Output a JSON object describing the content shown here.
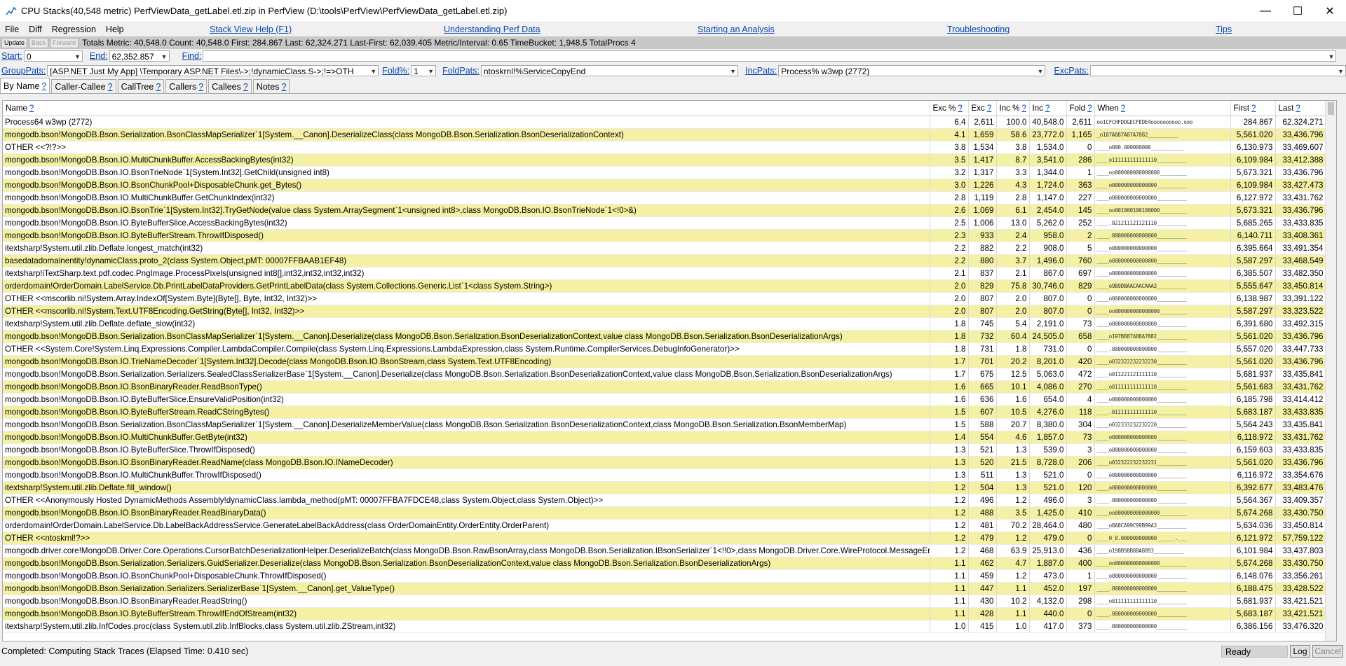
{
  "window": {
    "title": "CPU Stacks(40,548 metric) PerfViewData_getLabel.etl.zip in PerfView (D:\\tools\\PerfView\\PerfViewData_getLabel.etl.zip)",
    "minimize": "—",
    "maximize": "☐",
    "close": "✕"
  },
  "menu": {
    "items": [
      "File",
      "Diff",
      "Regression",
      "Help"
    ],
    "links": [
      "Stack View Help (F1)",
      "Understanding Perf Data",
      "Starting an Analysis",
      "Troubleshooting",
      "Tips"
    ]
  },
  "toolbar": {
    "update": "Update",
    "back": "Back",
    "forward": "Forward",
    "totals": "Totals Metric: 40,548.0  Count: 40,548.0  First: 284.867  Last: 62,324.271  Last-First: 62,039.405  Metric/Interval: 0.65  TimeBucket: 1,948.5  TotalProcs 4"
  },
  "filters": {
    "start_label": "Start:",
    "start_value": "0",
    "end_label": "End:",
    "end_value": "62,352.857",
    "find_label": "Find:",
    "find_value": "",
    "grouppats_label": "GroupPats:",
    "grouppats_value": "[ASP.NET Just My App] \\Temporary ASP.NET Files\\->;!dynamicClass.S->;!=>OTH",
    "fold_label": "Fold%:",
    "fold_value": "1",
    "foldpats_label": "FoldPats:",
    "foldpats_value": "ntoskrnl!%ServiceCopyEnd",
    "incpats_label": "IncPats:",
    "incpats_value": "Process% w3wp (2772)",
    "excpats_label": "ExcPats:",
    "excpats_value": ""
  },
  "tabs": [
    "By Name",
    "Caller-Callee",
    "CallTree",
    "Callers",
    "Callees",
    "Notes"
  ],
  "help_mark": "?",
  "columns": [
    "Name",
    "Exc %",
    "Exc",
    "Inc %",
    "Inc",
    "Fold",
    "When",
    "First",
    "Last"
  ],
  "rows": [
    {
      "name": "Process64 w3wp (2772)",
      "exc_pct": "6.4",
      "exc": "2,611",
      "inc_pct": "100.0",
      "inc": "40,548.0",
      "fold": "2,611",
      "when": "oo1CFCHFDDGECFEDE4oooooooooo.ooo",
      "first": "284.867",
      "last": "62,324.271",
      "hl": false
    },
    {
      "name": "mongodb.bson!MongoDB.Bson.Serialization.BsonClassMapSerializer`1[System.__Canon].DeserializeClass(class MongoDB.Bson.Serialization.BsonDeserializationContext)",
      "exc_pct": "4.1",
      "exc": "1,659",
      "inc_pct": "58.6",
      "inc": "23,772.0",
      "fold": "1,165",
      "when": "_o187A887A87A7882__________",
      "first": "5,561.020",
      "last": "33,436.796",
      "hl": true
    },
    {
      "name": "OTHER <<?!?>>",
      "exc_pct": "3.8",
      "exc": "1,534",
      "inc_pct": "3.8",
      "inc": "1,534.0",
      "fold": "0",
      "when": "____o000.000000000___________",
      "first": "6,130.973",
      "last": "33,469.607",
      "hl": false
    },
    {
      "name": "mongodb.bson!MongoDB.Bson.IO.MultiChunkBuffer.AccessBackingBytes(int32)",
      "exc_pct": "3.5",
      "exc": "1,417",
      "inc_pct": "8.7",
      "inc": "3,541.0",
      "fold": "286",
      "when": "____o111111111111110__________",
      "first": "6,109.984",
      "last": "33,412.388",
      "hl": true
    },
    {
      "name": "mongodb.bson!MongoDB.Bson.IO.BsonTrieNode`1[System.Int32].GetChild(unsigned int8)",
      "exc_pct": "3.2",
      "exc": "1,317",
      "inc_pct": "3.3",
      "inc": "1,344.0",
      "fold": "1",
      "when": "____oo000000000000000_________",
      "first": "5,673.321",
      "last": "33,436.796",
      "hl": false
    },
    {
      "name": "mongodb.bson!MongoDB.Bson.IO.BsonChunkPool+DisposableChunk.get_Bytes()",
      "exc_pct": "3.0",
      "exc": "1,226",
      "inc_pct": "4.3",
      "inc": "1,724.0",
      "fold": "363",
      "when": "____o000000000000000__________",
      "first": "6,109.984",
      "last": "33,427.473",
      "hl": true
    },
    {
      "name": "mongodb.bson!MongoDB.Bson.IO.MultiChunkBuffer.GetChunkIndex(int32)",
      "exc_pct": "2.8",
      "exc": "1,119",
      "inc_pct": "2.8",
      "inc": "1,147.0",
      "fold": "227",
      "when": "____o000000000000000__________",
      "first": "6,127.972",
      "last": "33,431.762",
      "hl": false
    },
    {
      "name": "mongodb.bson!MongoDB.Bson.IO.BsonTrie`1[System.Int32].TryGetNode(value class System.ArraySegment`1<unsigned int8>,class MongoDB.Bson.IO.BsonTrieNode`1<!0>&)",
      "exc_pct": "2.6",
      "exc": "1,069",
      "inc_pct": "6.1",
      "inc": "2,454.0",
      "fold": "145",
      "when": "____oo001000100100000_________",
      "first": "5,673.321",
      "last": "33,436.796",
      "hl": true
    },
    {
      "name": "mongodb.bson!MongoDB.Bson.IO.ByteBufferSlice.AccessBackingBytes(int32)",
      "exc_pct": "2.5",
      "exc": "1,006",
      "inc_pct": "13.0",
      "inc": "5,262.0",
      "fold": "252",
      "when": "____.021211121121110__________",
      "first": "5,685.265",
      "last": "33,433.835",
      "hl": false
    },
    {
      "name": "mongodb.bson!MongoDB.Bson.IO.ByteBufferStream.ThrowIfDisposed()",
      "exc_pct": "2.3",
      "exc": "933",
      "inc_pct": "2.4",
      "inc": "958.0",
      "fold": "2",
      "when": "____.000000000000000__________",
      "first": "6,140.711",
      "last": "33,408.361",
      "hl": true
    },
    {
      "name": "itextsharp!System.util.zlib.Deflate.longest_match(int32)",
      "exc_pct": "2.2",
      "exc": "882",
      "inc_pct": "2.2",
      "inc": "908.0",
      "fold": "5",
      "when": "____o000000000000000__________",
      "first": "6,395.664",
      "last": "33,491.354",
      "hl": false
    },
    {
      "name": "basedatadomainentity!dynamicClass.proto_2(class System.Object,pMT: 00007FFBAAB1EF48)",
      "exc_pct": "2.2",
      "exc": "880",
      "inc_pct": "3.7",
      "inc": "1,496.0",
      "fold": "760",
      "when": "____o000000000000000__________",
      "first": "5,587.297",
      "last": "33,468.549",
      "hl": true
    },
    {
      "name": "itextsharp!iTextSharp.text.pdf.codec.PngImage.ProcessPixels(unsigned int8[],int32,int32,int32,int32)",
      "exc_pct": "2.1",
      "exc": "837",
      "inc_pct": "2.1",
      "inc": "867.0",
      "fold": "697",
      "when": "____o000000000000000__________",
      "first": "6,385.507",
      "last": "33,482.350",
      "hl": false
    },
    {
      "name": "orderdomain!OrderDomain.LabelService.Db.PrintLabelDataProviders.GetPrintLabelData(class System.Collections.Generic.List`1<class System.String>)",
      "exc_pct": "2.0",
      "exc": "829",
      "inc_pct": "75.8",
      "inc": "30,746.0",
      "fold": "829",
      "when": "____o9B9DBAACAACAAA3__________",
      "first": "5,555.647",
      "last": "33,450.814",
      "hl": true
    },
    {
      "name": "OTHER <<mscorlib.ni!System.Array.IndexOf[System.Byte](Byte[], Byte, Int32, Int32)>>",
      "exc_pct": "2.0",
      "exc": "807",
      "inc_pct": "2.0",
      "inc": "807.0",
      "fold": "0",
      "when": "____o000000000000000__________",
      "first": "6,138.987",
      "last": "33,391.122",
      "hl": false
    },
    {
      "name": "OTHER <<mscorlib.ni!System.Text.UTF8Encoding.GetString(Byte[], Int32, Int32)>>",
      "exc_pct": "2.0",
      "exc": "807",
      "inc_pct": "2.0",
      "inc": "807.0",
      "fold": "0",
      "when": "____oo000000000000000_________",
      "first": "5,587.297",
      "last": "33,323.522",
      "hl": true
    },
    {
      "name": "itextsharp!System.util.zlib.Deflate.deflate_slow(int32)",
      "exc_pct": "1.8",
      "exc": "745",
      "inc_pct": "5.4",
      "inc": "2,191.0",
      "fold": "73",
      "when": "____o000000000000000__________",
      "first": "6,391.680",
      "last": "33,492.315",
      "hl": false
    },
    {
      "name": "mongodb.bson!MongoDB.Bson.Serialization.BsonClassMapSerializer`1[System.__Canon].Deserialize(class MongoDB.Bson.Serialization.BsonDeserializationContext,value class MongoDB.Bson.Serialization.BsonDeserializationArgs)",
      "exc_pct": "1.8",
      "exc": "732",
      "inc_pct": "60.4",
      "inc": "24,505.0",
      "fold": "658",
      "when": "____o197B887A88A7882__________",
      "first": "5,561.020",
      "last": "33,436.796",
      "hl": true
    },
    {
      "name": "OTHER <<System.Core!System.Linq.Expressions.Compiler.LambdaCompiler.Compile(class System.Linq.Expressions.LambdaExpression,class System.Runtime.CompilerServices.DebugInfoGenerator)>>",
      "exc_pct": "1.8",
      "exc": "731",
      "inc_pct": "1.8",
      "inc": "731.0",
      "fold": "0",
      "when": "____.000000000000000__________",
      "first": "5,557.020",
      "last": "33,447.733",
      "hl": false
    },
    {
      "name": "mongodb.bson!MongoDB.Bson.IO.TrieNameDecoder`1[System.Int32].Decode(class MongoDB.Bson.IO.BsonStream,class System.Text.UTF8Encoding)",
      "exc_pct": "1.7",
      "exc": "701",
      "inc_pct": "20.2",
      "inc": "8,201.0",
      "fold": "420",
      "when": "____o032322232232230__________",
      "first": "5,561.020",
      "last": "33,436.796",
      "hl": true
    },
    {
      "name": "mongodb.bson!MongoDB.Bson.Serialization.Serializers.SealedClassSerializerBase`1[System.__Canon].Deserialize(class MongoDB.Bson.Serialization.BsonDeserializationContext,value class MongoDB.Bson.Serialization.BsonDeserializationArgs)",
      "exc_pct": "1.7",
      "exc": "675",
      "inc_pct": "12.5",
      "inc": "5,063.0",
      "fold": "472",
      "when": "____o011221121111110__________",
      "first": "5,681.937",
      "last": "33,435.841",
      "hl": false
    },
    {
      "name": "mongodb.bson!MongoDB.Bson.IO.BsonBinaryReader.ReadBsonType()",
      "exc_pct": "1.6",
      "exc": "665",
      "inc_pct": "10.1",
      "inc": "4,086.0",
      "fold": "270",
      "when": "____o011111111111110__________",
      "first": "5,561.683",
      "last": "33,431.762",
      "hl": true
    },
    {
      "name": "mongodb.bson!MongoDB.Bson.IO.ByteBufferSlice.EnsureValidPosition(int32)",
      "exc_pct": "1.6",
      "exc": "636",
      "inc_pct": "1.6",
      "inc": "654.0",
      "fold": "4",
      "when": "____o000000000000000__________",
      "first": "6,185.798",
      "last": "33,414.412",
      "hl": false
    },
    {
      "name": "mongodb.bson!MongoDB.Bson.IO.ByteBufferStream.ReadCStringBytes()",
      "exc_pct": "1.5",
      "exc": "607",
      "inc_pct": "10.5",
      "inc": "4,276.0",
      "fold": "118",
      "when": "____.011111111111110__________",
      "first": "5,683.187",
      "last": "33,433.835",
      "hl": true
    },
    {
      "name": "mongodb.bson!MongoDB.Bson.Serialization.BsonClassMapSerializer`1[System.__Canon].DeserializeMemberValue(class MongoDB.Bson.Serialization.BsonDeserializationContext,class MongoDB.Bson.Serialization.BsonMemberMap)",
      "exc_pct": "1.5",
      "exc": "588",
      "inc_pct": "20.7",
      "inc": "8,380.0",
      "fold": "304",
      "when": "____o032333232232220__________",
      "first": "5,564.243",
      "last": "33,435.841",
      "hl": false
    },
    {
      "name": "mongodb.bson!MongoDB.Bson.IO.MultiChunkBuffer.GetByte(int32)",
      "exc_pct": "1.4",
      "exc": "554",
      "inc_pct": "4.6",
      "inc": "1,857.0",
      "fold": "73",
      "when": "____o000000000000000__________",
      "first": "6,118.972",
      "last": "33,431.762",
      "hl": true
    },
    {
      "name": "mongodb.bson!MongoDB.Bson.IO.ByteBufferSlice.ThrowIfDisposed()",
      "exc_pct": "1.3",
      "exc": "521",
      "inc_pct": "1.3",
      "inc": "539.0",
      "fold": "3",
      "when": "____o000000000000000__________",
      "first": "6,159.603",
      "last": "33,433.835",
      "hl": false
    },
    {
      "name": "mongodb.bson!MongoDB.Bson.IO.BsonBinaryReader.ReadName(class MongoDB.Bson.IO.INameDecoder)",
      "exc_pct": "1.3",
      "exc": "520",
      "inc_pct": "21.5",
      "inc": "8,728.0",
      "fold": "206",
      "when": "____o032322232232231__________",
      "first": "5,561.020",
      "last": "33,436.796",
      "hl": true
    },
    {
      "name": "mongodb.bson!MongoDB.Bson.IO.MultiChunkBuffer.ThrowIfDisposed()",
      "exc_pct": "1.3",
      "exc": "511",
      "inc_pct": "1.3",
      "inc": "521.0",
      "fold": "0",
      "when": "____o000000000000000__________",
      "first": "6,116.972",
      "last": "33,354.676",
      "hl": false
    },
    {
      "name": "itextsharp!System.util.zlib.Deflate.fill_window()",
      "exc_pct": "1.2",
      "exc": "504",
      "inc_pct": "1.3",
      "inc": "521.0",
      "fold": "120",
      "when": "____o000000000000000__________",
      "first": "6,392.677",
      "last": "33,483.476",
      "hl": true
    },
    {
      "name": "OTHER <<Anonymously Hosted DynamicMethods Assembly!dynamicClass.lambda_method(pMT: 00007FFBA7FDCE48,class System.Object,class System.Object)>>",
      "exc_pct": "1.2",
      "exc": "496",
      "inc_pct": "1.2",
      "inc": "496.0",
      "fold": "3",
      "when": "____.000000000000000__________",
      "first": "5,564.367",
      "last": "33,409.357",
      "hl": false
    },
    {
      "name": "mongodb.bson!MongoDB.Bson.IO.BsonBinaryReader.ReadBinaryData()",
      "exc_pct": "1.2",
      "exc": "488",
      "inc_pct": "3.5",
      "inc": "1,425.0",
      "fold": "410",
      "when": "____oo000000000000000_________",
      "first": "5,674.268",
      "last": "33,430.750",
      "hl": true
    },
    {
      "name": "orderdomain!OrderDomain.LabelService.Db.LabelBackAddressService.GenerateLabelBackAddress(class OrderDomainEntity.OrderEntity.OrderParent)",
      "exc_pct": "1.2",
      "exc": "481",
      "inc_pct": "70.2",
      "inc": "28,464.0",
      "fold": "480",
      "when": "____o8A8CA99C99B99A3__________",
      "first": "5,634.036",
      "last": "33,450.814",
      "hl": false
    },
    {
      "name": "OTHER <<ntoskrnl!?>>",
      "exc_pct": "1.2",
      "exc": "479",
      "inc_pct": "1.2",
      "inc": "479.0",
      "fold": "0",
      "when": "____0_0.000000000000______.___",
      "first": "6,121.972",
      "last": "57,759.122",
      "hl": true
    },
    {
      "name": "mongodb.driver.core!MongoDB.Driver.Core.Operations.CursorBatchDeserializationHelper.DeserializeBatch(class MongoDB.Bson.RawBsonArray,class MongoDB.Bson.Serialization.IBsonSerializer`1<!!0>,class MongoDB.Driver.Core.WireProtocol.MessageEncoderSettings)",
      "exc_pct": "1.2",
      "exc": "468",
      "inc_pct": "63.9",
      "inc": "25,913.0",
      "fold": "436",
      "when": "____o198B98B88A8893__________",
      "first": "6,101.984",
      "last": "33,437.803",
      "hl": false
    },
    {
      "name": "mongodb.bson!MongoDB.Bson.Serialization.Serializers.GuidSerializer.Deserialize(class MongoDB.Bson.Serialization.BsonDeserializationContext,value class MongoDB.Bson.Serialization.BsonDeserializationArgs)",
      "exc_pct": "1.1",
      "exc": "462",
      "inc_pct": "4.7",
      "inc": "1,887.0",
      "fold": "400",
      "when": "____oo000000000000000_________",
      "first": "5,674.268",
      "last": "33,430.750",
      "hl": true
    },
    {
      "name": "mongodb.bson!MongoDB.Bson.IO.BsonChunkPool+DisposableChunk.ThrowIfDisposed()",
      "exc_pct": "1.1",
      "exc": "459",
      "inc_pct": "1.2",
      "inc": "473.0",
      "fold": "1",
      "when": "____o000000000000000__________",
      "first": "6,148.076",
      "last": "33,356.261",
      "hl": false
    },
    {
      "name": "mongodb.bson!MongoDB.Bson.Serialization.Serializers.SerializerBase`1[System.__Canon].get_ValueType()",
      "exc_pct": "1.1",
      "exc": "447",
      "inc_pct": "1.1",
      "inc": "452.0",
      "fold": "197",
      "when": "____.000000000000000__________",
      "first": "6,188.475",
      "last": "33,428.522",
      "hl": true
    },
    {
      "name": "mongodb.bson!MongoDB.Bson.IO.BsonBinaryReader.ReadString()",
      "exc_pct": "1.1",
      "exc": "430",
      "inc_pct": "10.2",
      "inc": "4,132.0",
      "fold": "298",
      "when": "____o011111111111110__________",
      "first": "5,681.937",
      "last": "33,421.521",
      "hl": false
    },
    {
      "name": "mongodb.bson!MongoDB.Bson.IO.ByteBufferStream.ThrowIfEndOfStream(int32)",
      "exc_pct": "1.1",
      "exc": "428",
      "inc_pct": "1.1",
      "inc": "440.0",
      "fold": "0",
      "when": "____.000000000000000__________",
      "first": "5,683.187",
      "last": "33,421.521",
      "hl": true
    },
    {
      "name": "itextsharp!System.util.zlib.InfCodes.proc(class System.util.zlib.InfBlocks,class System.util.zlib.ZStream,int32)",
      "exc_pct": "1.0",
      "exc": "415",
      "inc_pct": "1.0",
      "inc": "417.0",
      "fold": "373",
      "when": "____.000000000000000__________",
      "first": "6,386.156",
      "last": "33,476.320",
      "hl": false
    }
  ],
  "status": {
    "message": "Completed: Computing Stack Traces   (Elapsed Time: 0.410 sec)",
    "ready": "Ready",
    "log": "Log",
    "cancel": "Cancel"
  }
}
